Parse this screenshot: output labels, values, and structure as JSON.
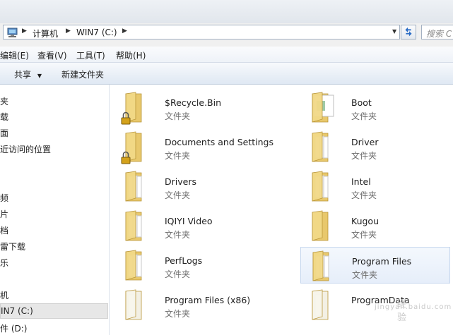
{
  "address": {
    "crumbs": [
      "计算机",
      "WIN7 (C:)"
    ],
    "search_placeholder": "搜索 C"
  },
  "menu": [
    "编辑(E)",
    "查看(V)",
    "工具(T)",
    "帮助(H)"
  ],
  "toolbar": {
    "share": "共享",
    "new_folder": "新建文件夹"
  },
  "nav": {
    "items": [
      "夹",
      "载",
      "面",
      "近访问的位置",
      "频",
      "片",
      "档",
      "雷下载",
      "乐",
      "机",
      "IN7 (C:)",
      "件 (D:)"
    ],
    "selected_index": 10
  },
  "files": [
    {
      "name": "$Recycle.Bin",
      "type": "文件夹",
      "locked": true,
      "style": "plain"
    },
    {
      "name": "Boot",
      "type": "文件夹",
      "locked": false,
      "style": "boot"
    },
    {
      "name": "Documents and Settings",
      "type": "文件夹",
      "locked": true,
      "style": "plain"
    },
    {
      "name": "Driver",
      "type": "文件夹",
      "locked": false,
      "style": "docs"
    },
    {
      "name": "Drivers",
      "type": "文件夹",
      "locked": false,
      "style": "docs"
    },
    {
      "name": "Intel",
      "type": "文件夹",
      "locked": false,
      "style": "docs"
    },
    {
      "name": "IQIYI Video",
      "type": "文件夹",
      "locked": false,
      "style": "docs"
    },
    {
      "name": "Kugou",
      "type": "文件夹",
      "locked": false,
      "style": "plain"
    },
    {
      "name": "PerfLogs",
      "type": "文件夹",
      "locked": false,
      "style": "docs"
    },
    {
      "name": "Program Files",
      "type": "文件夹",
      "locked": false,
      "style": "docs",
      "selected": true
    },
    {
      "name": "Program Files (x86)",
      "type": "文件夹",
      "locked": false,
      "style": "pale"
    },
    {
      "name": "ProgramData",
      "type": "",
      "locked": false,
      "style": "pale"
    }
  ],
  "watermark": {
    "main": "经验",
    "sub": "jingyan.baidu.com"
  }
}
